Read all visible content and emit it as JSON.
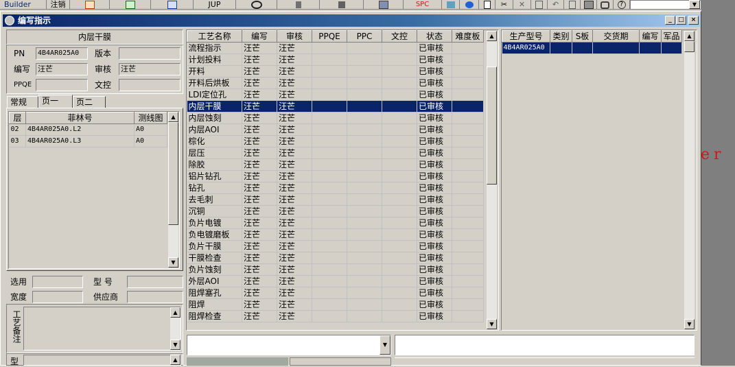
{
  "toolbar": {
    "builder_label": "Builder",
    "logout_label": "注销",
    "jup_label": "JUP",
    "spc_label": "SPC",
    "icons": [
      "report-icon",
      "excel-icon",
      "word-icon",
      "eye-icon",
      "database-icon",
      "network-icon",
      "computer-icon",
      "wireless-icon",
      "browser-icon",
      "new-doc-icon",
      "cut-icon",
      "delete-icon",
      "save-icon",
      "undo-icon",
      "preview-icon",
      "print-icon",
      "find-icon",
      "help-icon"
    ]
  },
  "window": {
    "title": "编写指示",
    "min_label": "_",
    "max_label": "□",
    "close_label": "×"
  },
  "left": {
    "header": "内层干膜",
    "pn_label": "PN",
    "pn_value": "4B4AR025A0",
    "version_label": "版本",
    "version_value": "",
    "writer_label": "编写",
    "writer_value": "汪芒",
    "review_label": "审核",
    "review_value": "汪芒",
    "ppqe_label": "PPQE",
    "ppqe_value": "",
    "doc_label": "文控",
    "doc_value": "",
    "tabs": [
      "常规",
      "页一",
      "页二"
    ],
    "layer_columns": [
      "层",
      "菲林号",
      "测线图"
    ],
    "layer_rows": [
      {
        "layer": "02",
        "film": "4B4AR025A0.L2",
        "map": "A0"
      },
      {
        "layer": "03",
        "film": "4B4AR025A0.L3",
        "map": "A0"
      }
    ],
    "select_label": "选用",
    "model_label": "型  号",
    "width_label": "宽度",
    "supplier_label": "供应商",
    "remark_label": "工艺备注",
    "bottom_label": "型"
  },
  "process_grid": {
    "columns": [
      "工艺名称",
      "编写",
      "审核",
      "PPQE",
      "PPC",
      "文控",
      "状态",
      "难度板"
    ],
    "selected_index": 5,
    "rows": [
      {
        "name": "流程指示",
        "writer": "汪芒",
        "review": "汪芒",
        "status": "已审核"
      },
      {
        "name": "计划投料",
        "writer": "汪芒",
        "review": "汪芒",
        "status": "已审核"
      },
      {
        "name": "开料",
        "writer": "汪芒",
        "review": "汪芒",
        "status": "已审核"
      },
      {
        "name": "开料后烘板",
        "writer": "汪芒",
        "review": "汪芒",
        "status": "已审核"
      },
      {
        "name": "LDI定位孔",
        "writer": "汪芒",
        "review": "汪芒",
        "status": "已审核"
      },
      {
        "name": "内层干膜",
        "writer": "汪芒",
        "review": "汪芒",
        "status": "已审核"
      },
      {
        "name": "内层蚀刻",
        "writer": "汪芒",
        "review": "汪芒",
        "status": "已审核"
      },
      {
        "name": "内层AOI",
        "writer": "汪芒",
        "review": "汪芒",
        "status": "已审核"
      },
      {
        "name": "棕化",
        "writer": "汪芒",
        "review": "汪芒",
        "status": "已审核"
      },
      {
        "name": "层压",
        "writer": "汪芒",
        "review": "汪芒",
        "status": "已审核"
      },
      {
        "name": "除胶",
        "writer": "汪芒",
        "review": "汪芒",
        "status": "已审核"
      },
      {
        "name": "铝片钻孔",
        "writer": "汪芒",
        "review": "汪芒",
        "status": "已审核"
      },
      {
        "name": "钻孔",
        "writer": "汪芒",
        "review": "汪芒",
        "status": "已审核"
      },
      {
        "name": "去毛刺",
        "writer": "汪芒",
        "review": "汪芒",
        "status": "已审核"
      },
      {
        "name": "沉铜",
        "writer": "汪芒",
        "review": "汪芒",
        "status": "已审核"
      },
      {
        "name": "负片电镀",
        "writer": "汪芒",
        "review": "汪芒",
        "status": "已审核"
      },
      {
        "name": "负电镀磨板",
        "writer": "汪芒",
        "review": "汪芒",
        "status": "已审核"
      },
      {
        "name": "负片干膜",
        "writer": "汪芒",
        "review": "汪芒",
        "status": "已审核"
      },
      {
        "name": "干膜检查",
        "writer": "汪芒",
        "review": "汪芒",
        "status": "已审核"
      },
      {
        "name": "负片蚀刻",
        "writer": "汪芒",
        "review": "汪芒",
        "status": "已审核"
      },
      {
        "name": "外层AOI",
        "writer": "汪芒",
        "review": "汪芒",
        "status": "已审核"
      },
      {
        "name": "阻焊塞孔",
        "writer": "汪芒",
        "review": "汪芒",
        "status": "已审核"
      },
      {
        "name": "阻焊",
        "writer": "汪芒",
        "review": "汪芒",
        "status": "已审核"
      },
      {
        "name": "阻焊检查",
        "writer": "汪芒",
        "review": "汪芒",
        "status": "已审核"
      }
    ]
  },
  "order_grid": {
    "columns": [
      "生产型号",
      "类别",
      "S板",
      "交货期",
      "编写",
      "军品"
    ],
    "rows": [
      {
        "model": "4B4AR025A0"
      }
    ]
  },
  "desktop_text": "er S",
  "colors": {
    "selection": "#0a246a",
    "window_bg": "#d4d0c8",
    "title_start": "#0a246a",
    "title_end": "#a6caf0",
    "desktop_text": "#e01010"
  }
}
